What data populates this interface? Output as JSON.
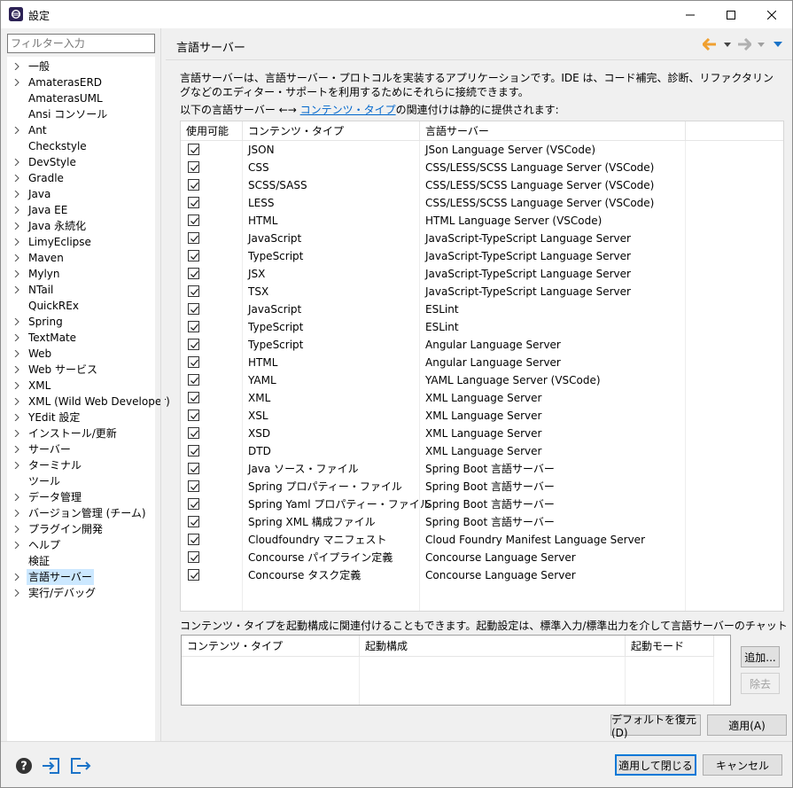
{
  "window": {
    "title": "設定"
  },
  "filter": {
    "placeholder": "フィルター入力"
  },
  "tree": [
    {
      "label": "一般",
      "expandable": true
    },
    {
      "label": "AmaterasERD",
      "expandable": true
    },
    {
      "label": "AmaterasUML",
      "expandable": false
    },
    {
      "label": "Ansi コンソール",
      "expandable": false
    },
    {
      "label": "Ant",
      "expandable": true
    },
    {
      "label": "Checkstyle",
      "expandable": false
    },
    {
      "label": "DevStyle",
      "expandable": true
    },
    {
      "label": "Gradle",
      "expandable": true
    },
    {
      "label": "Java",
      "expandable": true
    },
    {
      "label": "Java EE",
      "expandable": true
    },
    {
      "label": "Java 永続化",
      "expandable": true
    },
    {
      "label": "LimyEclipse",
      "expandable": true
    },
    {
      "label": "Maven",
      "expandable": true
    },
    {
      "label": "Mylyn",
      "expandable": true
    },
    {
      "label": "NTail",
      "expandable": true
    },
    {
      "label": "QuickREx",
      "expandable": false
    },
    {
      "label": "Spring",
      "expandable": true
    },
    {
      "label": "TextMate",
      "expandable": true
    },
    {
      "label": "Web",
      "expandable": true
    },
    {
      "label": "Web サービス",
      "expandable": true
    },
    {
      "label": "XML",
      "expandable": true
    },
    {
      "label": "XML (Wild Web Developer)",
      "expandable": true
    },
    {
      "label": "YEdit 設定",
      "expandable": true
    },
    {
      "label": "インストール/更新",
      "expandable": true
    },
    {
      "label": "サーバー",
      "expandable": true
    },
    {
      "label": "ターミナル",
      "expandable": true
    },
    {
      "label": "ツール",
      "expandable": false
    },
    {
      "label": "データ管理",
      "expandable": true
    },
    {
      "label": "バージョン管理 (チーム)",
      "expandable": true
    },
    {
      "label": "プラグイン開発",
      "expandable": true
    },
    {
      "label": "ヘルプ",
      "expandable": true
    },
    {
      "label": "検証",
      "expandable": false
    },
    {
      "label": "言語サーバー",
      "expandable": true,
      "selected": true
    },
    {
      "label": "実行/デバッグ",
      "expandable": true
    }
  ],
  "page": {
    "title": "言語サーバー",
    "description": "言語サーバーは、言語サーバー・プロトコルを実装するアプリケーションです。IDE は、コード補完、診断、リファクタリングなどのエディター・サポートを利用するためにそれらに接続できます。",
    "intro_prefix": "以下の言語サーバー ←→ ",
    "intro_link": "コンテンツ・タイプ",
    "intro_suffix": "の関連付けは静的に提供されます:",
    "columns": {
      "enabled": "使用可能",
      "content_type": "コンテンツ・タイプ",
      "language_server": "言語サーバー"
    },
    "rows": [
      {
        "ct": "JSON",
        "ls": "JSon Language Server (VSCode)"
      },
      {
        "ct": "CSS",
        "ls": "CSS/LESS/SCSS Language Server (VSCode)"
      },
      {
        "ct": "SCSS/SASS",
        "ls": "CSS/LESS/SCSS Language Server (VSCode)"
      },
      {
        "ct": "LESS",
        "ls": "CSS/LESS/SCSS Language Server (VSCode)"
      },
      {
        "ct": "HTML",
        "ls": "HTML Language Server (VSCode)"
      },
      {
        "ct": "JavaScript",
        "ls": "JavaScript-TypeScript Language Server"
      },
      {
        "ct": "TypeScript",
        "ls": "JavaScript-TypeScript Language Server"
      },
      {
        "ct": "JSX",
        "ls": "JavaScript-TypeScript Language Server"
      },
      {
        "ct": "TSX",
        "ls": "JavaScript-TypeScript Language Server"
      },
      {
        "ct": "JavaScript",
        "ls": "ESLint"
      },
      {
        "ct": "TypeScript",
        "ls": "ESLint"
      },
      {
        "ct": "TypeScript",
        "ls": "Angular Language Server"
      },
      {
        "ct": "HTML",
        "ls": "Angular Language Server"
      },
      {
        "ct": "YAML",
        "ls": "YAML Language Server (VSCode)"
      },
      {
        "ct": "XML",
        "ls": "XML Language Server"
      },
      {
        "ct": "XSL",
        "ls": "XML Language Server"
      },
      {
        "ct": "XSD",
        "ls": "XML Language Server"
      },
      {
        "ct": "DTD",
        "ls": "XML Language Server"
      },
      {
        "ct": "Java ソース・ファイル",
        "ls": "Spring Boot 言語サーバー"
      },
      {
        "ct": "Spring プロパティー・ファイル",
        "ls": "Spring Boot 言語サーバー"
      },
      {
        "ct": "Spring Yaml プロパティー・ファイル",
        "ls": "Spring Boot 言語サーバー"
      },
      {
        "ct": "Spring XML 構成ファイル",
        "ls": "Spring Boot 言語サーバー"
      },
      {
        "ct": "Cloudfoundry マニフェスト",
        "ls": "Cloud Foundry Manifest Language Server"
      },
      {
        "ct": "Concourse パイプライン定義",
        "ls": "Concourse Language Server"
      },
      {
        "ct": "Concourse タスク定義",
        "ls": "Concourse Language Server"
      }
    ],
    "assoc_label": "コンテンツ・タイプを起動構成に関連付けることもできます。起動設定は、標準入力/標準出力を介して言語サーバーのチャットを開始します。",
    "assoc_columns": {
      "content_type": "コンテンツ・タイプ",
      "launch_config": "起動構成",
      "launch_mode": "起動モード"
    },
    "buttons": {
      "add": "追加...",
      "remove": "除去",
      "restore": "デフォルトを復元(D)",
      "apply": "適用(A)"
    }
  },
  "footer": {
    "apply_close": "適用して閉じる",
    "cancel": "キャンセル"
  },
  "colors": {
    "accent": "#0078d7",
    "link": "#0066cc",
    "selection": "#cce8ff",
    "nav_back": "#f0a030"
  }
}
